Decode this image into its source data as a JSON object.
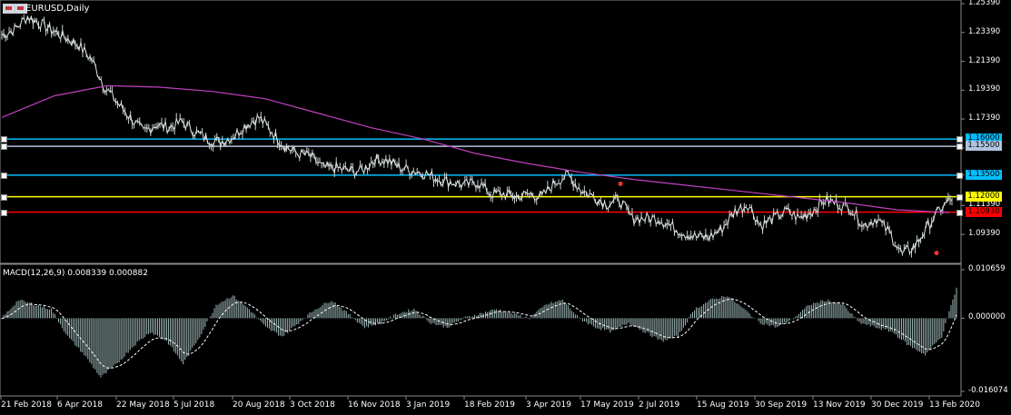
{
  "window": {
    "symbol_title": "EURUSD,Daily",
    "flag_icon": "eu-us-flag-icon"
  },
  "price_axis": {
    "ticks": [
      "1.25390",
      "1.23390",
      "1.21390",
      "1.19390",
      "1.17390",
      "1.15390",
      "1.13500",
      "1.11390",
      "1.09390"
    ]
  },
  "horizontal_lines": [
    {
      "price": "1.16000",
      "color": "#00bfff"
    },
    {
      "price": "1.15500",
      "color": "#b0c4de"
    },
    {
      "price": "1.13500",
      "color": "#00bfff"
    },
    {
      "price": "1.12000",
      "color": "#ffff00"
    },
    {
      "price": "1.10930",
      "color": "#ff0000"
    }
  ],
  "macd": {
    "label": "MACD(12,26,9) 0.008339 0.000882",
    "axis": [
      "0.010659",
      "0.000000",
      "-0.016074"
    ]
  },
  "time_axis": [
    "21 Feb 2018",
    "6 Apr 2018",
    "22 May 2018",
    "5 Jul 2018",
    "20 Aug 2018",
    "3 Oct 2018",
    "16 Nov 2018",
    "3 Jan 2019",
    "18 Feb 2019",
    "3 Apr 2019",
    "17 May 2019",
    "2 Jul 2019",
    "15 Aug 2019",
    "30 Sep 2019",
    "13 Nov 2019",
    "30 Dec 2019",
    "13 Feb 2020"
  ],
  "chart_data": {
    "type": "line",
    "title": "EURUSD,Daily",
    "series": [
      {
        "name": "EURUSD",
        "values": [
          1.232,
          1.236,
          1.245,
          1.24,
          1.235,
          1.23,
          1.225,
          1.215,
          1.196,
          1.185,
          1.175,
          1.165,
          1.17,
          1.168,
          1.172,
          1.165,
          1.16,
          1.158,
          1.162,
          1.17,
          1.175,
          1.165,
          1.155,
          1.15,
          1.148,
          1.14,
          1.14,
          1.138,
          1.138,
          1.146,
          1.145,
          1.14,
          1.138,
          1.136,
          1.132,
          1.13,
          1.128,
          1.13,
          1.122,
          1.122,
          1.12,
          1.122,
          1.12,
          1.13,
          1.135,
          1.125,
          1.12,
          1.115,
          1.118,
          1.105,
          1.105,
          1.105,
          1.1,
          1.095,
          1.092,
          1.092,
          1.098,
          1.11,
          1.115,
          1.1,
          1.105,
          1.11,
          1.105,
          1.11,
          1.118,
          1.115,
          1.112,
          1.1,
          1.105,
          1.095,
          1.08,
          1.086,
          1.1,
          1.112,
          1.12
        ]
      },
      {
        "name": "MA",
        "values": [
          1.175,
          1.19,
          1.197,
          1.196,
          1.193,
          1.188,
          1.178,
          1.168,
          1.16,
          1.15,
          1.143,
          1.137,
          1.132,
          1.128,
          1.124,
          1.12,
          1.116,
          1.111,
          1.109
        ]
      }
    ],
    "macd_values": [
      0.0,
      0.004,
      0.003,
      0.002,
      -0.004,
      -0.008,
      -0.013,
      -0.01,
      -0.006,
      -0.003,
      -0.005,
      -0.01,
      -0.004,
      0.003,
      0.005,
      0.002,
      -0.002,
      -0.004,
      -0.001,
      0.002,
      0.004,
      0.001,
      -0.002,
      -0.001,
      0.001,
      0.002,
      -0.001,
      -0.002,
      0.0,
      0.001,
      0.002,
      0.001,
      0.0,
      0.003,
      0.004,
      0.0,
      -0.002,
      -0.003,
      -0.001,
      -0.003,
      -0.005,
      -0.004,
      0.002,
      0.004,
      0.005,
      0.002,
      -0.001,
      -0.002,
      0.0,
      0.003,
      0.004,
      0.003,
      -0.001,
      -0.002,
      -0.003,
      -0.006,
      -0.008,
      -0.004,
      0.008
    ]
  }
}
